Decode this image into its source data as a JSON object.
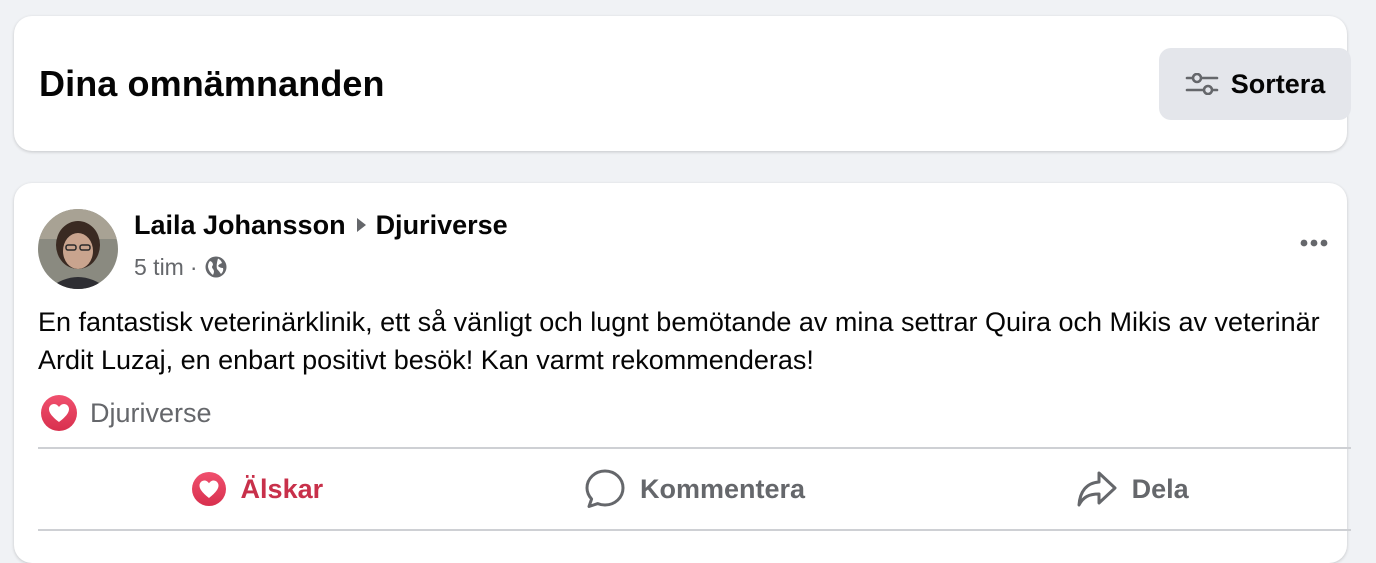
{
  "header": {
    "title": "Dina omnämnanden",
    "sort_label": "Sortera",
    "sort_icon": "sliders-icon"
  },
  "post": {
    "author": "Laila Johansson",
    "target": "Djuriverse",
    "time": "5 tim",
    "separator": "·",
    "privacy_icon": "globe-icon",
    "text": "En fantastisk veterinärklinik, ett så vänligt och lugnt bemötande av mina settrar Quira och Mikis av veterinär Ardit Luzaj, en enbart positivt besök! Kan varmt rekommenderas!",
    "reaction": {
      "icon": "heart-reaction-icon",
      "name": "Djuriverse"
    },
    "actions": {
      "love": "Älskar",
      "comment": "Kommentera",
      "share": "Dela"
    }
  },
  "colors": {
    "page_background": "#f0f2f5",
    "card_background": "#ffffff",
    "love_red": "#c8304a",
    "secondary_text": "#65676b",
    "button_gray": "#e4e6eb"
  }
}
